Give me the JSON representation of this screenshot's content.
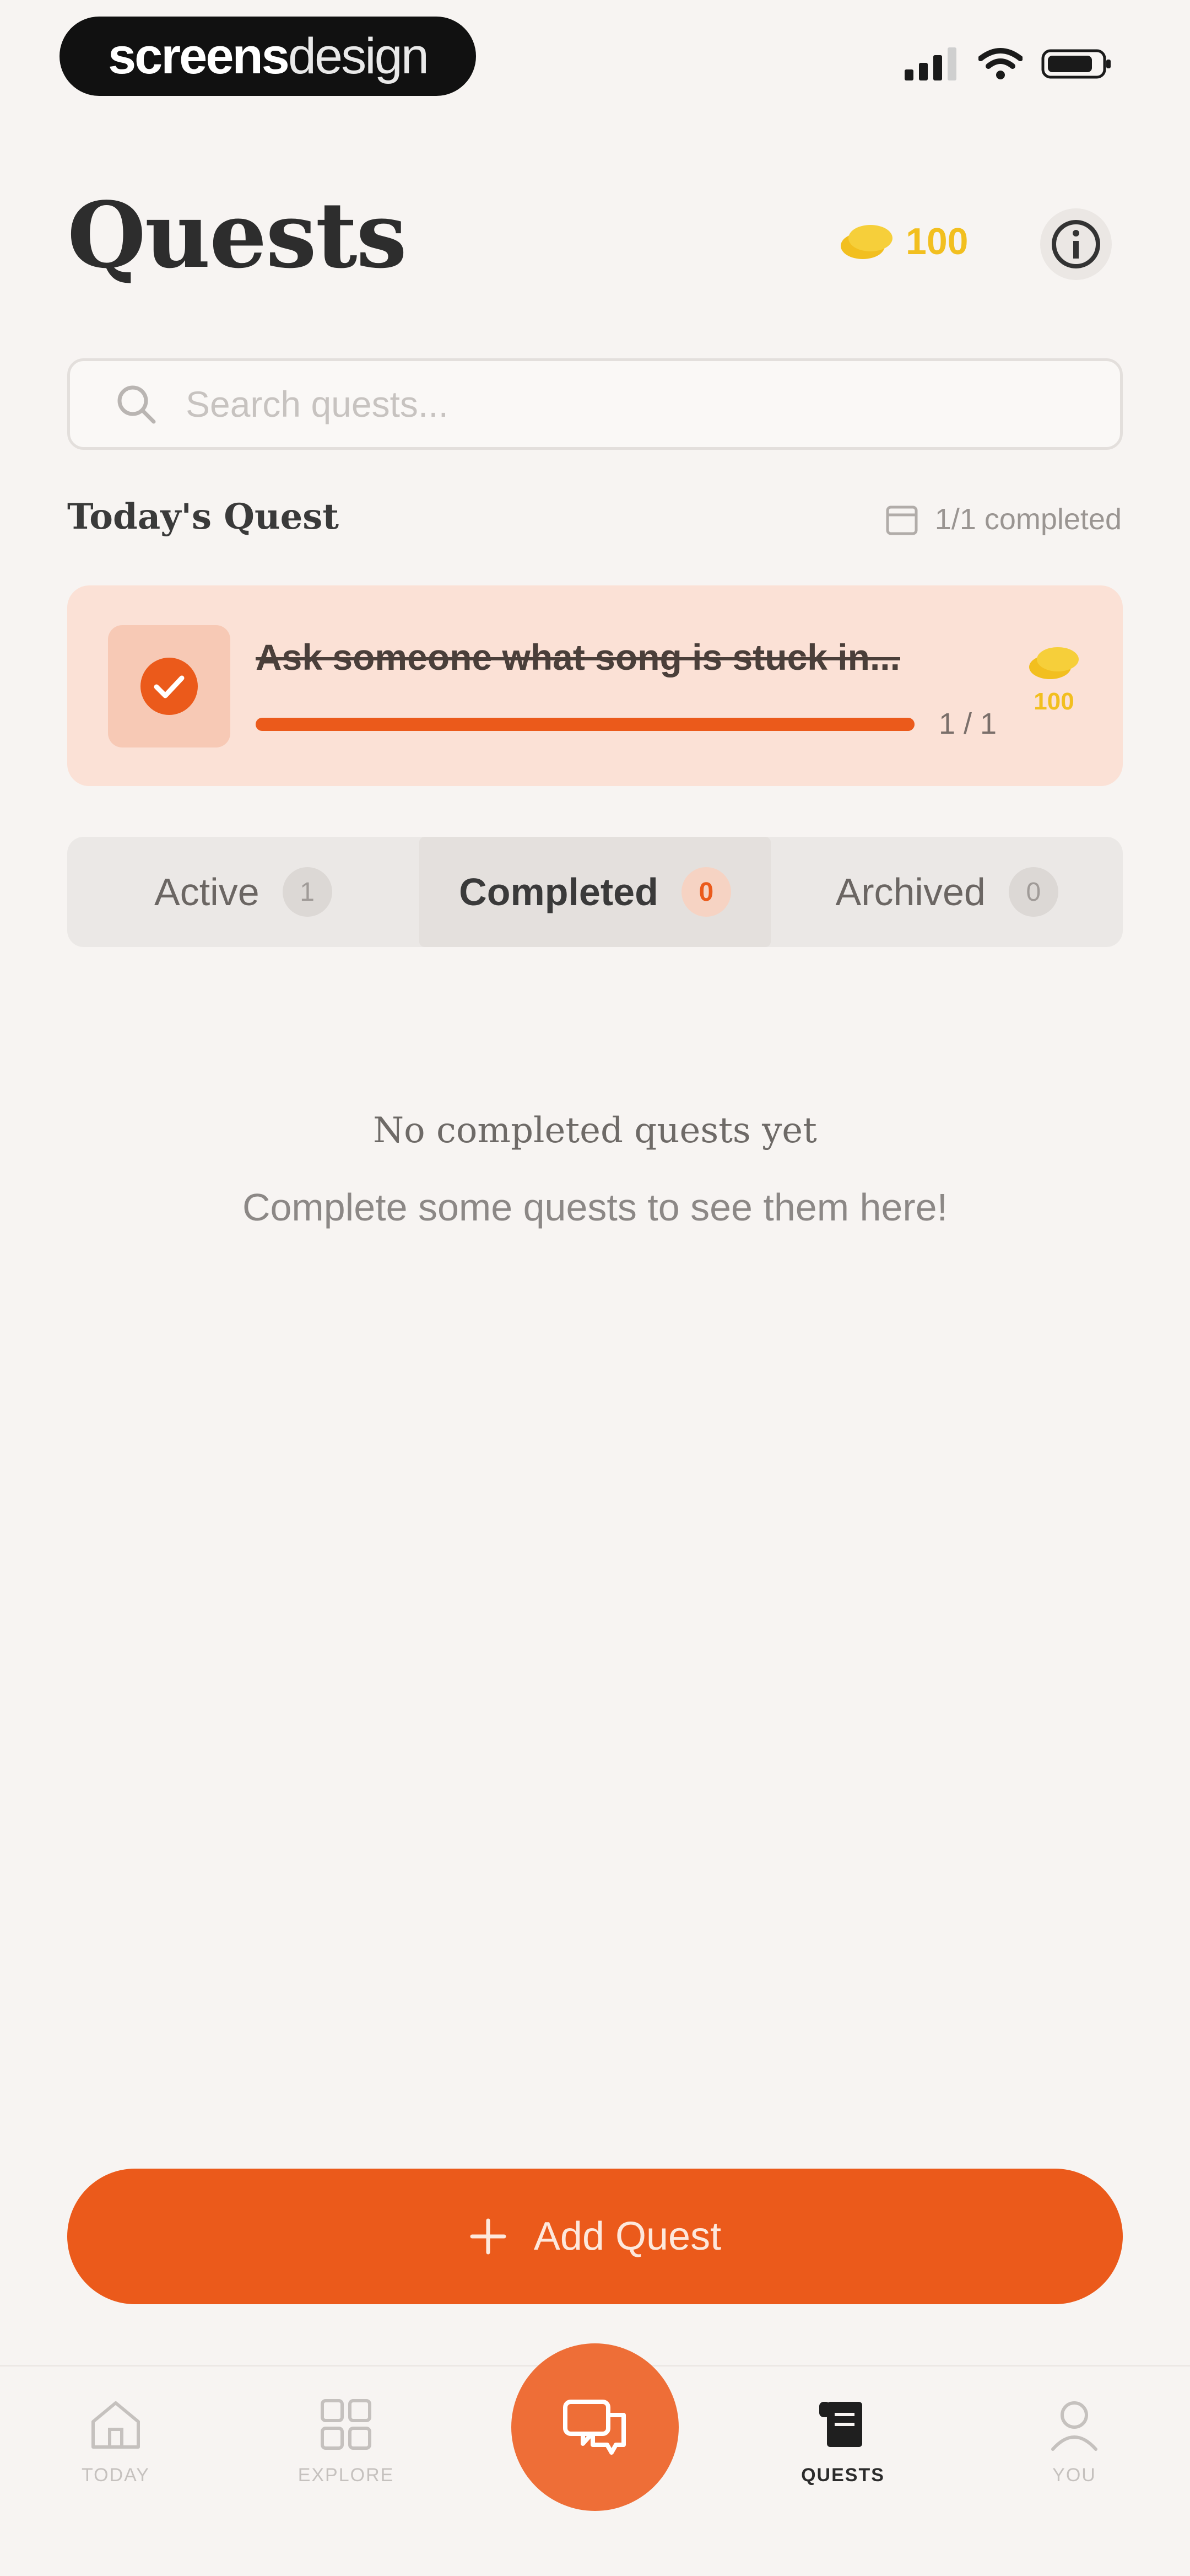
{
  "status_bar": {
    "brand_bold": "screens",
    "brand_light": "design"
  },
  "header": {
    "title": "Quests",
    "coins": "100"
  },
  "search": {
    "placeholder": "Search quests..."
  },
  "today": {
    "title": "Today's Quest",
    "completed_count": "1/1 completed",
    "quest": {
      "text": "Ask someone what song is stuck in...",
      "progress_label": "1 / 1",
      "progress": 1.0,
      "reward": "100"
    }
  },
  "tabs": [
    {
      "label": "Active",
      "count": "1"
    },
    {
      "label": "Completed",
      "count": "0"
    },
    {
      "label": "Archived",
      "count": "0"
    }
  ],
  "empty_state": {
    "title": "No completed quests yet",
    "subtitle": "Complete some quests to see them here!"
  },
  "add_button": {
    "label": "Add Quest"
  },
  "nav": {
    "today": "TODAY",
    "explore": "EXPLORE",
    "quests": "QUESTS",
    "you": "YOU"
  },
  "colors": {
    "accent": "#eb5a1b",
    "coin": "#f2bf1f",
    "card_bg": "#fbe1d6",
    "background": "#f7f4f2"
  }
}
